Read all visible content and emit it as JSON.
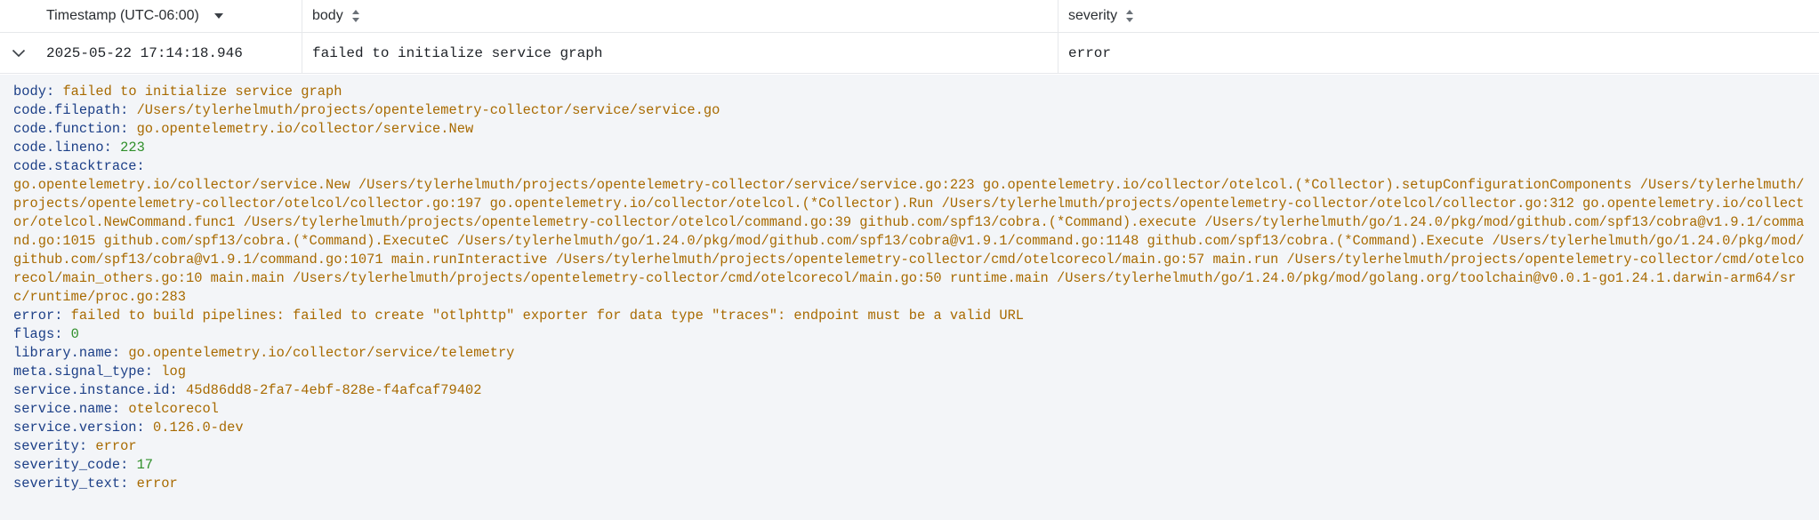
{
  "table": {
    "columns": {
      "timestamp": "Timestamp (UTC-06:00)",
      "body": "body",
      "severity": "severity"
    },
    "row": {
      "timestamp": "2025-05-22 17:14:18.946",
      "body": "failed to initialize service graph",
      "severity": "error"
    }
  },
  "detail": [
    {
      "key": "body",
      "value": "failed to initialize service graph",
      "type": "string"
    },
    {
      "key": "code.filepath",
      "value": "/Users/tylerhelmuth/projects/opentelemetry-collector/service/service.go",
      "type": "string"
    },
    {
      "key": "code.function",
      "value": "go.opentelemetry.io/collector/service.New",
      "type": "string"
    },
    {
      "key": "code.lineno",
      "value": "223",
      "type": "number"
    },
    {
      "key": "code.stacktrace",
      "value": "",
      "type": "string"
    },
    {
      "key": "",
      "value": "go.opentelemetry.io/collector/service.New /Users/tylerhelmuth/projects/opentelemetry-collector/service/service.go:223 go.opentelemetry.io/collector/otelcol.(*Collector).setupConfigurationComponents /Users/tylerhelmuth/projects/opentelemetry-collector/otelcol/collector.go:197 go.opentelemetry.io/collector/otelcol.(*Collector).Run /Users/tylerhelmuth/projects/opentelemetry-collector/otelcol/collector.go:312 go.opentelemetry.io/collector/otelcol.NewCommand.func1 /Users/tylerhelmuth/projects/opentelemetry-collector/otelcol/command.go:39 github.com/spf13/cobra.(*Command).execute /Users/tylerhelmuth/go/1.24.0/pkg/mod/github.com/spf13/cobra@v1.9.1/command.go:1015 github.com/spf13/cobra.(*Command).ExecuteC /Users/tylerhelmuth/go/1.24.0/pkg/mod/github.com/spf13/cobra@v1.9.1/command.go:1148 github.com/spf13/cobra.(*Command).Execute /Users/tylerhelmuth/go/1.24.0/pkg/mod/github.com/spf13/cobra@v1.9.1/command.go:1071 main.runInteractive /Users/tylerhelmuth/projects/opentelemetry-collector/cmd/otelcorecol/main.go:57 main.run /Users/tylerhelmuth/projects/opentelemetry-collector/cmd/otelcorecol/main_others.go:10 main.main /Users/tylerhelmuth/projects/opentelemetry-collector/cmd/otelcorecol/main.go:50 runtime.main /Users/tylerhelmuth/go/1.24.0/pkg/mod/golang.org/toolchain@v0.0.1-go1.24.1.darwin-arm64/src/runtime/proc.go:283",
      "type": "stack"
    },
    {
      "key": "error",
      "value": "failed to build pipelines: failed to create \"otlphttp\" exporter for data type \"traces\": endpoint must be a valid URL",
      "type": "string"
    },
    {
      "key": "flags",
      "value": "0",
      "type": "number"
    },
    {
      "key": "library.name",
      "value": "go.opentelemetry.io/collector/service/telemetry",
      "type": "string"
    },
    {
      "key": "meta.signal_type",
      "value": "log",
      "type": "string"
    },
    {
      "key": "service.instance.id",
      "value": "45d86dd8-2fa7-4ebf-828e-f4afcaf79402",
      "type": "string"
    },
    {
      "key": "service.name",
      "value": "otelcorecol",
      "type": "string"
    },
    {
      "key": "service.version",
      "value": "0.126.0-dev",
      "type": "string"
    },
    {
      "key": "severity",
      "value": "error",
      "type": "string"
    },
    {
      "key": "severity_code",
      "value": "17",
      "type": "number"
    },
    {
      "key": "severity_text",
      "value": "error",
      "type": "string"
    }
  ],
  "colors": {
    "key": "#1c3f87",
    "string_value": "#a86a00",
    "number_value": "#2f8f2a",
    "detail_background": "#f3f5f8",
    "border": "#e6e8eb"
  },
  "icons": {
    "timestamp_sort": "caret-down-icon",
    "body_sort": "sort-updown-icon",
    "severity_sort": "sort-updown-icon",
    "row_expand": "chevron-down-icon"
  }
}
